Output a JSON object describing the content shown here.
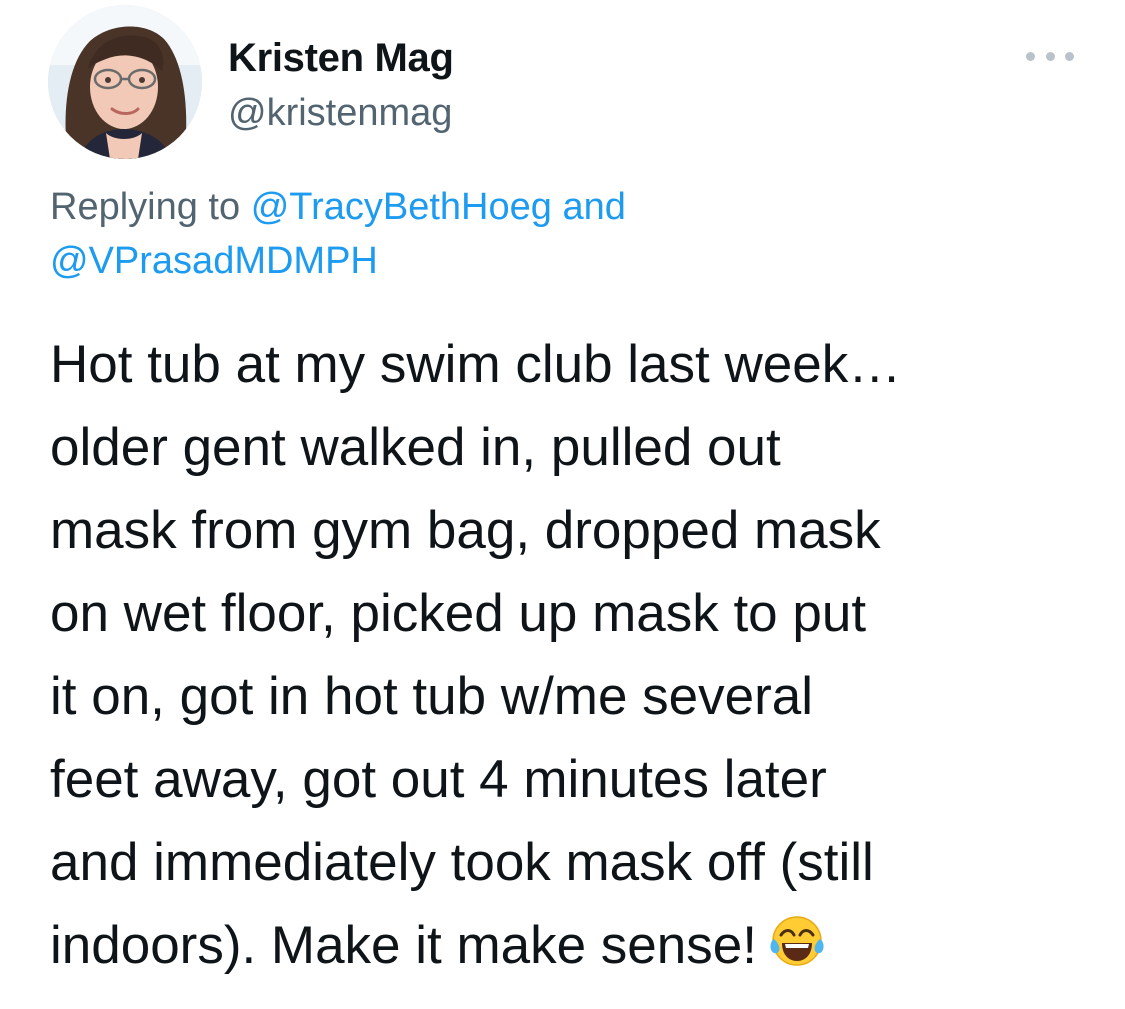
{
  "tweet": {
    "author": {
      "display_name": "Kristen Mag",
      "handle": "@kristenmag"
    },
    "more_icon": "more-horizontal-icon",
    "reply_context": {
      "prefix": "Replying to",
      "mention_1": "@TracyBethHoeg",
      "conjunction": "and",
      "mention_2": "@VPrasadMDMPH"
    },
    "text_lines": [
      "Hot tub at my swim club last week…",
      "older gent walked in, pulled out",
      "mask from gym bag, dropped mask",
      "on wet floor, picked up mask to put",
      "it on, got in hot tub w/me several",
      "feet away, got out 4 minutes later",
      "and immediately took mask off (still",
      "indoors). Make it make sense!"
    ],
    "emoji": "face-with-tears-of-joy-emoji"
  },
  "colors": {
    "text": "#0f1419",
    "secondary": "#536471",
    "link": "#1d9bf0",
    "more_dots": "#b9c2ca"
  }
}
